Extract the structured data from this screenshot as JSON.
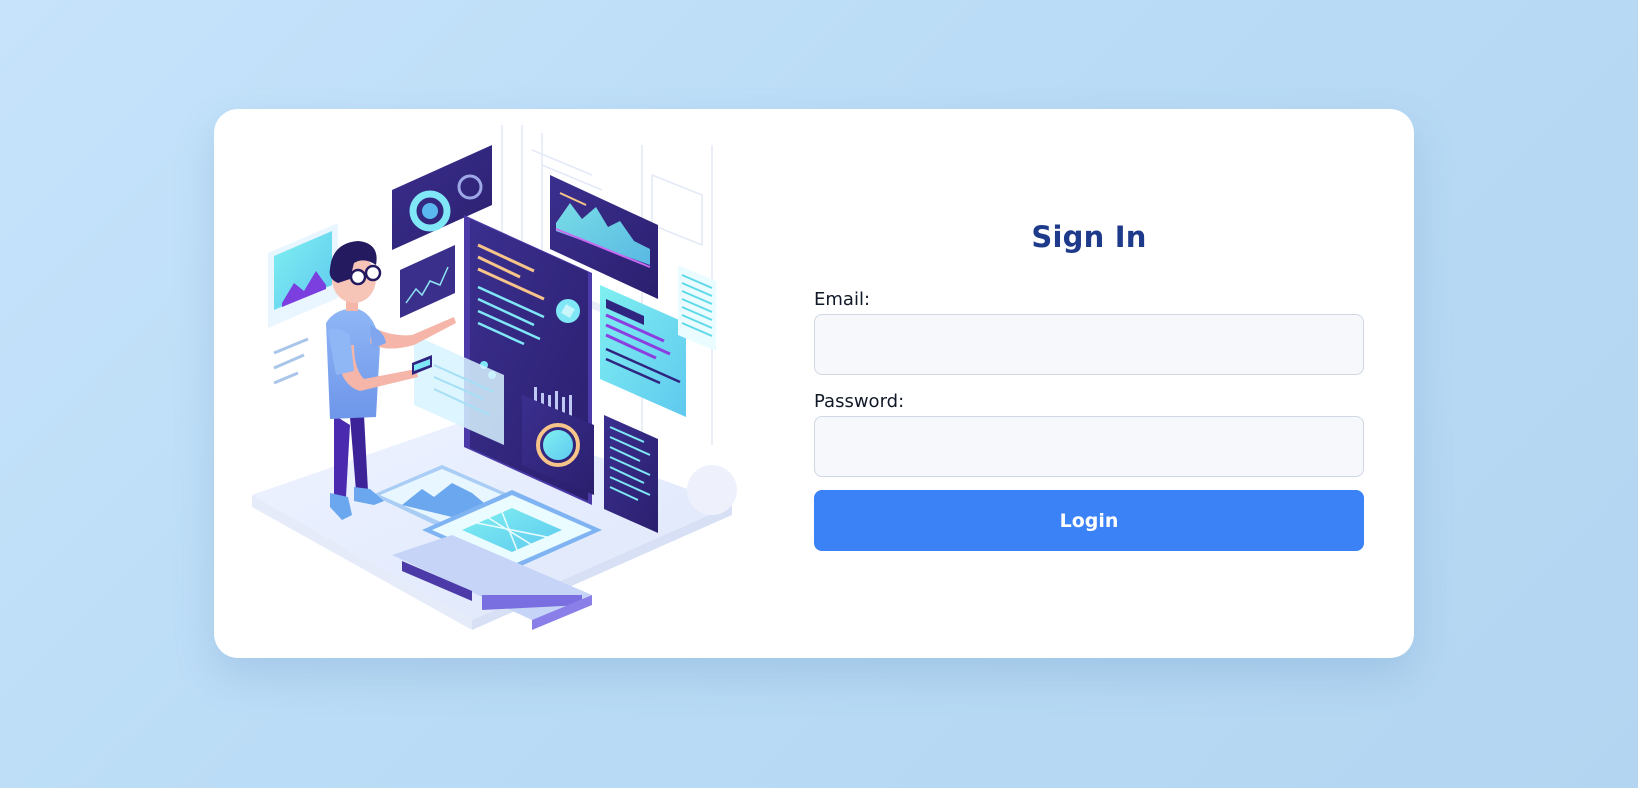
{
  "form": {
    "title": "Sign In",
    "email_label": "Email:",
    "email_value": "",
    "password_label": "Password:",
    "password_value": "",
    "login_label": "Login"
  },
  "colors": {
    "background": "#bcdcf6",
    "card": "#ffffff",
    "title": "#1e3a8a",
    "button": "#3b82f6",
    "input_bg": "#f6f8fb",
    "input_border": "#cfd8e3"
  },
  "illustration": {
    "subject": "person-with-data-dashboards-icon"
  }
}
